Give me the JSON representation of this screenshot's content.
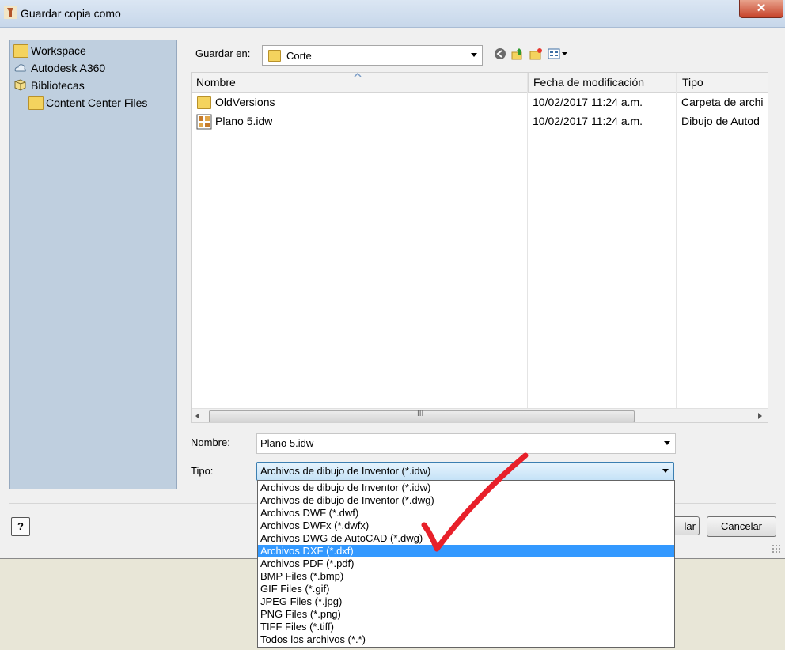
{
  "window": {
    "title": "Guardar copia como",
    "close_label": "✕"
  },
  "places": [
    {
      "label": "Workspace",
      "icon": "folder-icon"
    },
    {
      "label": "Autodesk A360",
      "icon": "cloud-icon"
    },
    {
      "label": "Bibliotecas",
      "icon": "library-icon"
    },
    {
      "label": "Content Center Files",
      "icon": "folder-icon"
    }
  ],
  "save_in": {
    "label": "Guardar en:",
    "value": "Corte"
  },
  "file_list": {
    "columns": [
      "Nombre",
      "Fecha de modificación",
      "Tipo"
    ],
    "rows": [
      {
        "name": "OldVersions",
        "date": "10/02/2017 11:24 a.m.",
        "type": "Carpeta de archi",
        "icon": "folder-icon"
      },
      {
        "name": "Plano 5.idw",
        "date": "10/02/2017 11:24 a.m.",
        "type": "Dibujo de Autod",
        "icon": "inventor-drawing-icon"
      }
    ]
  },
  "filename": {
    "label": "Nombre:",
    "value": "Plano 5.idw"
  },
  "filetype": {
    "label": "Tipo:",
    "value": "Archivos de dibujo de Inventor (*.idw)",
    "options": [
      "Archivos de dibujo de Inventor (*.idw)",
      "Archivos de dibujo de Inventor (*.dwg)",
      "Archivos DWF (*.dwf)",
      "Archivos DWFx (*.dwfx)",
      "Archivos DWG de AutoCAD (*.dwg)",
      "Archivos DXF (*.dxf)",
      "Archivos PDF (*.pdf)",
      "BMP Files (*.bmp)",
      "GIF Files (*.gif)",
      "JPEG Files (*.jpg)",
      "PNG Files (*.png)",
      "TIFF Files (*.tiff)",
      "Todos los archivos (*.*)"
    ],
    "selected_index": 5
  },
  "buttons": {
    "save": "lar",
    "cancel": "Cancelar",
    "help": "?"
  },
  "scrollbar": {
    "thumb_label": "III"
  },
  "colors": {
    "selection": "#3399ff",
    "annotation": "#e8202a",
    "places_bg": "#bfcfdf"
  }
}
